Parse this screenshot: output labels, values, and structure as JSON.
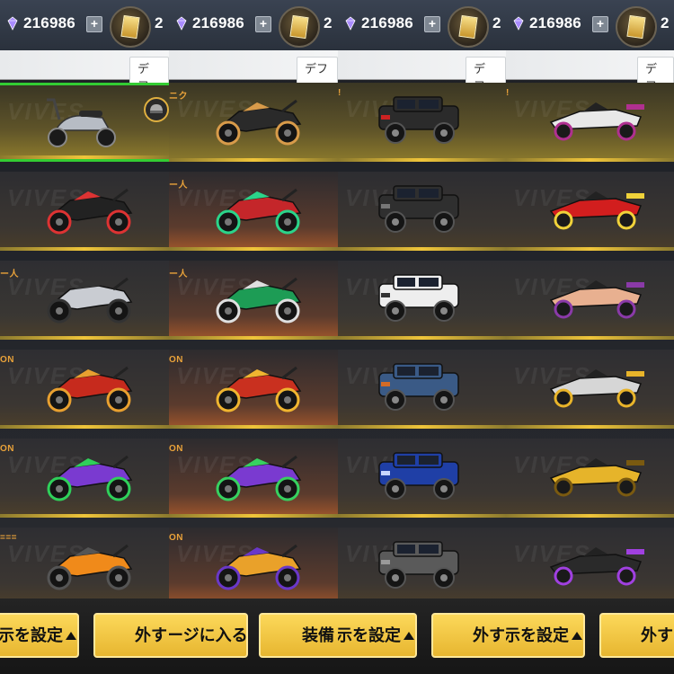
{
  "panels": [
    {
      "currency_gems": "216986",
      "currency_second": "2",
      "default_tab": "デフォ",
      "items": [
        {
          "type": "scooter",
          "tag": "",
          "selected": true
        },
        {
          "type": "bat-bike",
          "tag": ""
        },
        {
          "type": "silver-bike",
          "tag": "ー人"
        },
        {
          "type": "red-bike",
          "tag": "ON"
        },
        {
          "type": "purple-bike",
          "tag": "ON"
        },
        {
          "type": "orange-bike",
          "tag": "==="
        }
      ],
      "btn_left": "示を設定",
      "btn_right": "外す"
    },
    {
      "currency_gems": "216986",
      "currency_second": "2",
      "default_tab": "デフォ",
      "items": [
        {
          "type": "teddy-chopper",
          "tag": "ニク"
        },
        {
          "type": "red-sport-bike",
          "tag": "ー人"
        },
        {
          "type": "green-sport-bike",
          "tag": "ー人"
        },
        {
          "type": "red-cyber-bike",
          "tag": "ON"
        },
        {
          "type": "purple-cyber-bike",
          "tag": "ON"
        },
        {
          "type": "gold-cyber-bike",
          "tag": "ON"
        }
      ],
      "btn_left": "ージに入る",
      "btn_right": "装備"
    },
    {
      "currency_gems": "216986",
      "currency_second": "2",
      "default_tab": "デフォ",
      "items": [
        {
          "type": "black-jeep",
          "tag": "!"
        },
        {
          "type": "armored-truck",
          "tag": ""
        },
        {
          "type": "white-jeep",
          "tag": ""
        },
        {
          "type": "six-wheeler",
          "tag": ""
        },
        {
          "type": "blue-suv",
          "tag": ""
        },
        {
          "type": "camo-jeep",
          "tag": ""
        }
      ],
      "btn_left": "示を設定",
      "btn_right": "外す"
    },
    {
      "currency_gems": "216986",
      "currency_second": "2",
      "default_tab": "デフォ",
      "items": [
        {
          "type": "white-racer",
          "tag": "!"
        },
        {
          "type": "red-f1",
          "tag": ""
        },
        {
          "type": "pink-dragster",
          "tag": ""
        },
        {
          "type": "mini-4wd-silver",
          "tag": ""
        },
        {
          "type": "mini-4wd-gold",
          "tag": ""
        },
        {
          "type": "mini-4wd-purple",
          "tag": ""
        }
      ],
      "btn_left": "示を設定",
      "btn_right": "外す"
    }
  ],
  "colors": {
    "accent_gold": "#f0c53a",
    "selected_green": "#33cc33",
    "gem_purple": "#a98bff"
  },
  "watermark_text": "VIVES"
}
